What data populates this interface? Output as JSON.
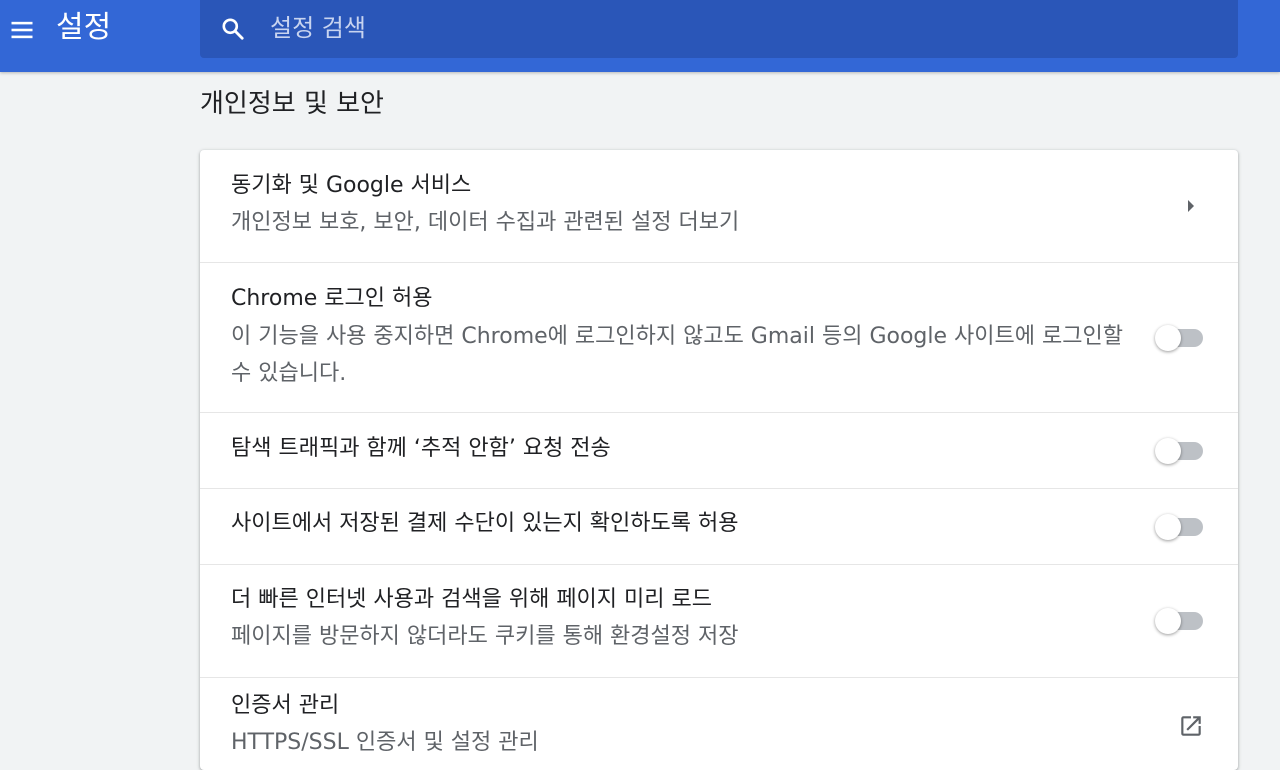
{
  "header": {
    "title": "설정",
    "search_placeholder": "설정 검색",
    "search_value": ""
  },
  "section": {
    "title": "개인정보 및 보안"
  },
  "rows": [
    {
      "label": "동기화 및 Google 서비스",
      "sublabel": "개인정보 보호, 보안, 데이터 수집과 관련된 설정 더보기",
      "control": "arrow"
    },
    {
      "label": "Chrome 로그인 허용",
      "sublabel": "이 기능을 사용 중지하면 Chrome에 로그인하지 않고도 Gmail 등의 Google 사이트에 로그인할 수 있습니다.",
      "control": "toggle",
      "checked": false
    },
    {
      "label": "탐색 트래픽과 함께 ‘추적 안함’ 요청 전송",
      "control": "toggle",
      "checked": false
    },
    {
      "label": "사이트에서 저장된 결제 수단이 있는지 확인하도록 허용",
      "control": "toggle",
      "checked": false
    },
    {
      "label": "더 빠른 인터넷 사용과 검색을 위해 페이지 미리 로드",
      "sublabel": "페이지를 방문하지 않더라도 쿠키를 통해 환경설정 저장",
      "control": "toggle",
      "checked": false
    },
    {
      "label": "인증서 관리",
      "sublabel": "HTTPS/SSL 인증서 및 설정 관리",
      "control": "external-link"
    }
  ],
  "icons": {
    "menu": "hamburger-menu-icon",
    "search": "search-icon",
    "arrow": "arrow-right-icon",
    "external": "open-in-new-icon"
  },
  "colors": {
    "toolbar": "#3367d6",
    "search_box": "#2a56b8",
    "background": "#f1f3f4",
    "toggle_off_track": "#bdc1c6"
  }
}
